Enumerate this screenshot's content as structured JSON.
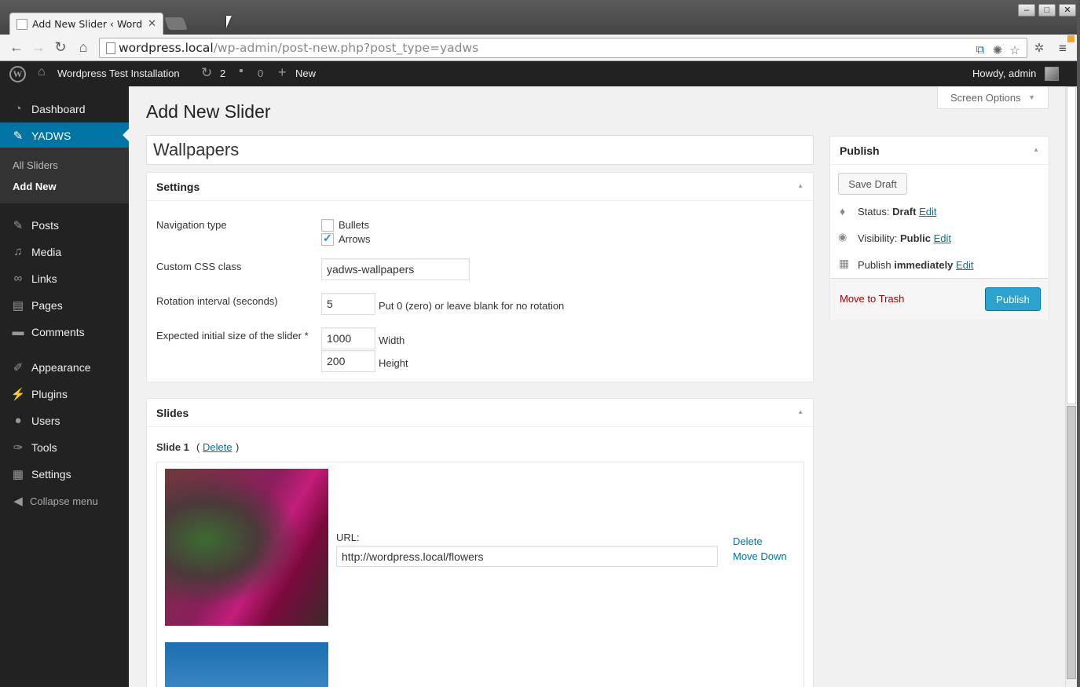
{
  "browser": {
    "tab_title": "Add New Slider ‹ Wordp",
    "url_host": "wordpress.local",
    "url_path": "/wp-admin/post-new.php?post_type=yadws"
  },
  "adminbar": {
    "site_name": "Wordpress Test Installation",
    "updates": "2",
    "comments": "0",
    "new": "New",
    "howdy": "Howdy, admin"
  },
  "sidebar": {
    "items": [
      {
        "label": "Dashboard",
        "icon": "dashboard-icon"
      },
      {
        "label": "YADWS",
        "icon": "pin-icon"
      },
      {
        "label": "Posts",
        "icon": "pin-icon"
      },
      {
        "label": "Media",
        "icon": "media-icon"
      },
      {
        "label": "Links",
        "icon": "link-icon"
      },
      {
        "label": "Pages",
        "icon": "pages-icon"
      },
      {
        "label": "Comments",
        "icon": "comment-icon"
      },
      {
        "label": "Appearance",
        "icon": "brush-icon"
      },
      {
        "label": "Plugins",
        "icon": "plug-icon"
      },
      {
        "label": "Users",
        "icon": "user-icon"
      },
      {
        "label": "Tools",
        "icon": "wrench-icon"
      },
      {
        "label": "Settings",
        "icon": "settings-icon"
      },
      {
        "label": "Collapse menu",
        "icon": "collapse-icon"
      }
    ],
    "submenu": [
      "All Sliders",
      "Add New"
    ]
  },
  "page": {
    "screen_options": "Screen Options",
    "title": "Add New Slider",
    "slider_title": "Wallpapers"
  },
  "settings": {
    "heading": "Settings",
    "nav_type_label": "Navigation type",
    "bullets_label": "Bullets",
    "bullets_checked": false,
    "arrows_label": "Arrows",
    "arrows_checked": true,
    "css_label": "Custom CSS class",
    "css_value": "yadws-wallpapers",
    "rotation_label": "Rotation interval (seconds)",
    "rotation_value": "5",
    "rotation_hint": "Put 0 (zero) or leave blank for no rotation",
    "size_label": "Expected initial size of the slider *",
    "width_value": "1000",
    "width_label": "Width",
    "height_value": "200",
    "height_label": "Height"
  },
  "slides": {
    "heading": "Slides",
    "slide1_label": "Slide 1",
    "paren_open": "(",
    "delete_link": "Delete",
    "paren_close": ")",
    "url_label": "URL:",
    "url_value": "http://wordpress.local/flowers",
    "delete_action": "Delete",
    "move_down": "Move Down"
  },
  "publish": {
    "heading": "Publish",
    "save_draft": "Save Draft",
    "status_label": "Status:",
    "status_value": "Draft",
    "visibility_label": "Visibility:",
    "visibility_value": "Public",
    "publish_label": "Publish",
    "publish_value": "immediately",
    "edit": "Edit",
    "trash": "Move to Trash",
    "publish_button": "Publish"
  },
  "colors": {
    "admin_bar": "#222222",
    "active_menu": "#0074a2",
    "publish_button": "#2ea2cc",
    "trash": "#a00000"
  }
}
